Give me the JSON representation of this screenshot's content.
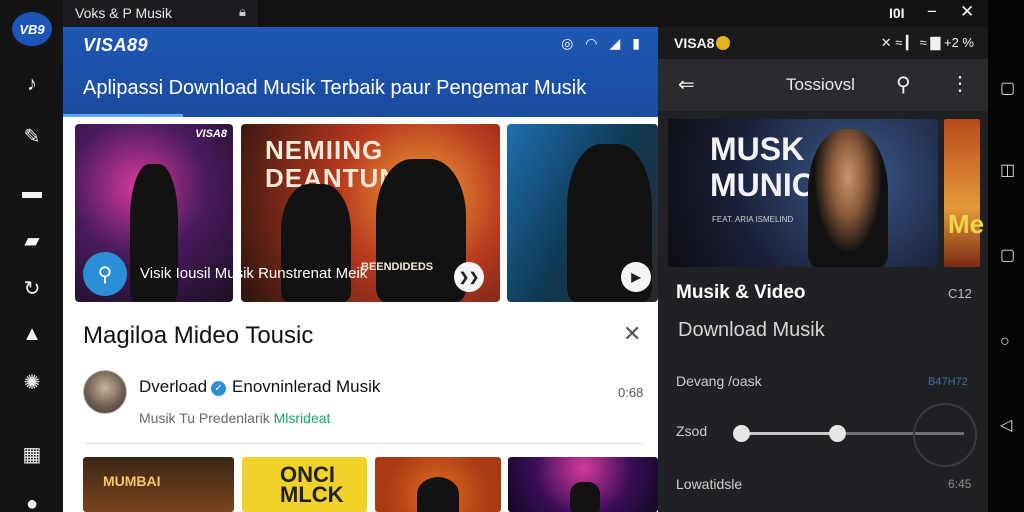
{
  "window": {
    "title": "Voks & P Musik",
    "controls": [
      "I0I",
      "−",
      "✕"
    ]
  },
  "rail": {
    "logo": "VB9",
    "icons": [
      "music-note-icon",
      "pen-icon",
      "flag-icon",
      "folder-icon",
      "refresh-icon",
      "camera-icon",
      "reel-icon",
      "grid-icon",
      "leaf-icon"
    ]
  },
  "left_app": {
    "brand": "VISA89",
    "status_icons": [
      "nfc-icon",
      "wifi-icon",
      "signal-icon",
      "battery-icon"
    ],
    "tagline": "Aplipassi Download Musik Terbaik paur Pengemar Musik",
    "cards": [
      {
        "mark": "VISA8",
        "caption": "Visik Iousil Musik Runstrenat Meik"
      },
      {
        "poster": "NEMIING\nDEANTUN",
        "sticker": "BEENDIDEDS"
      },
      {
        "label": ""
      }
    ],
    "section_title": "Magiloa  Mideo Tousic",
    "item": {
      "title_a": "Dverload",
      "title_b": "Enovninlerad Musik",
      "sub_a": "Musik Tu Predenlarik",
      "sub_b": "Mlsrideat",
      "time": "0:68"
    },
    "thumbs": [
      {
        "text": "MUMBAI"
      },
      {
        "text": "ONCI\nMLCK"
      },
      {
        "text": ""
      },
      {
        "text": ""
      }
    ]
  },
  "right_app": {
    "brand": "VISA8",
    "status": "✕ ≈ ▎ ≈ ▇ +2 %",
    "toolbar_title": "Tossiovsl",
    "banner_big": "MUSK\nMUNIC",
    "banner_sub": "FEAT. ARIA ISMELIND",
    "banner2_big": "Me",
    "heading": "Musik & Video",
    "code": "C12",
    "subheading": "Download Musik",
    "rows": [
      {
        "label": "Devang /oask",
        "value": "B47H72"
      },
      {
        "label": "Zsod",
        "value": ""
      },
      {
        "label": "Lowatidsle",
        "value": "6:45"
      }
    ],
    "slider": {
      "value_1": 0.0,
      "value_2": 0.45
    }
  },
  "sysnav": {
    "buttons": [
      "recent-square-icon",
      "bookmark-icon",
      "square-icon",
      "home-circle-icon",
      "back-triangle-icon"
    ]
  },
  "colors": {
    "accent_blue": "#1f58b4",
    "dark_panel": "#202124",
    "highlight_green": "#1aa36b",
    "brand_yellow": "#e3b21f"
  }
}
